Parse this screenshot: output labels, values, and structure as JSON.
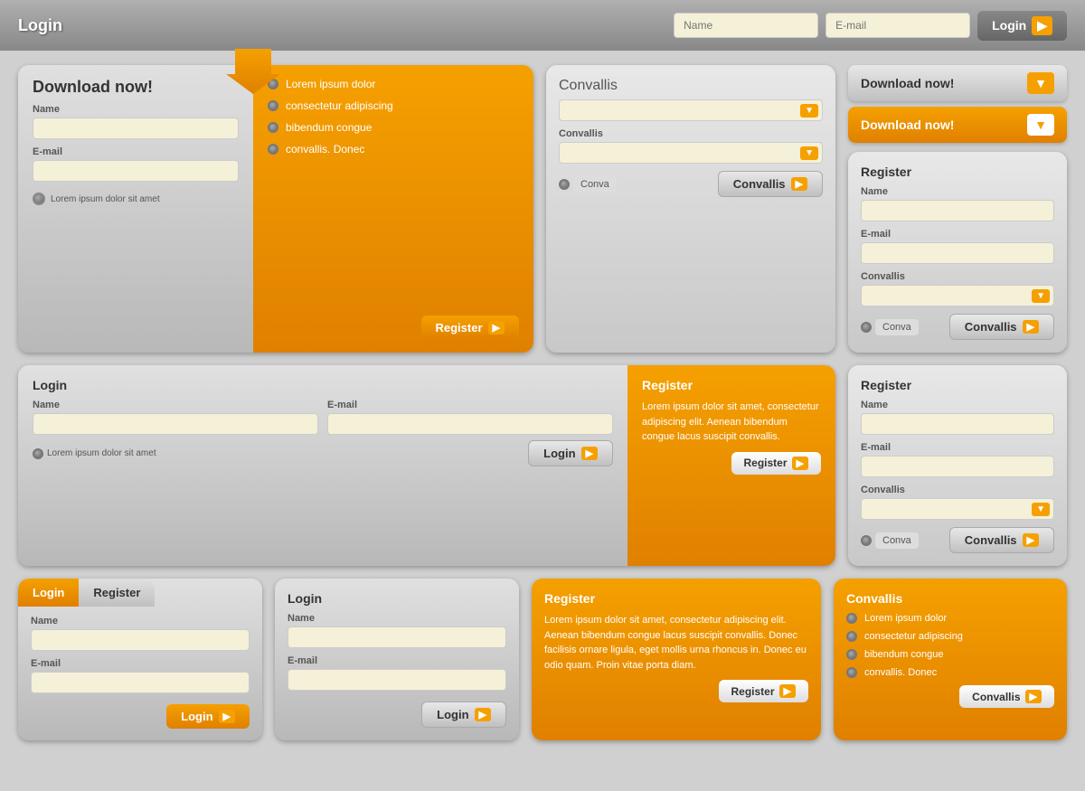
{
  "topnav": {
    "login_label": "Login",
    "name_placeholder": "Name",
    "email_placeholder": "E-mail",
    "login_btn": "Login"
  },
  "widget1": {
    "title": "Download now!",
    "name_label": "Name",
    "email_label": "E-mail",
    "footer_text": "Lorem ipsum dolor sit amet",
    "list": [
      "Lorem  ipsum  dolor",
      "consectetur adipiscing",
      "bibendum  congue",
      "convallis.  Donec"
    ],
    "register_btn": "Register"
  },
  "widget2": {
    "title": "Convallis",
    "label1": "Convallis",
    "label2": "Convallis",
    "conva_label": "Conva",
    "convallis_btn": "Convallis"
  },
  "widget3": {
    "dl_btn1": "Download now!",
    "dl_btn2": "Download now!",
    "register_title": "Register",
    "name_label": "Name",
    "email_label": "E-mail",
    "convallis_label": "Convallis",
    "conva_label": "Conva",
    "convallis_btn": "Convallis"
  },
  "row2_left": {
    "login_title": "Login",
    "name_label": "Name",
    "email_label": "E-mail",
    "footer_text": "Lorem ipsum dolor sit amet",
    "login_btn": "Login"
  },
  "row2_right_orange": {
    "title": "Register",
    "body": "Lorem ipsum dolor sit amet, consectetur adipiscing elit. Aenean bibendum congue lacus suscipit convallis.",
    "register_btn": "Register"
  },
  "row2_far_right": {
    "title": "Register",
    "name_label": "Name",
    "email_label": "E-mail",
    "convallis_label": "Convallis",
    "conva_label": "Conva",
    "convallis_btn": "Convallis"
  },
  "row3": {
    "w1": {
      "tab_login": "Login",
      "tab_register": "Register",
      "name_label": "Name",
      "email_label": "E-mail",
      "login_btn": "Login"
    },
    "w2": {
      "login_title": "Login",
      "name_label": "Name",
      "email_label": "E-mail",
      "login_btn": "Login"
    },
    "w3": {
      "title": "Register",
      "body": "Lorem ipsum dolor sit amet, consectetur adipiscing elit. Aenean bibendum congue lacus suscipit convallis. Donec facilisis ornare ligula, eget mollis urna rhoncus in. Donec eu odio quam. Proin vitae porta diam.",
      "register_btn": "Register"
    },
    "w4": {
      "title": "Convallis",
      "list": [
        "Lorem  ipsum  dolor",
        "consectetur adipiscing",
        "bibendum  congue",
        "convallis.  Donec"
      ],
      "convallis_btn": "Convallis"
    }
  }
}
